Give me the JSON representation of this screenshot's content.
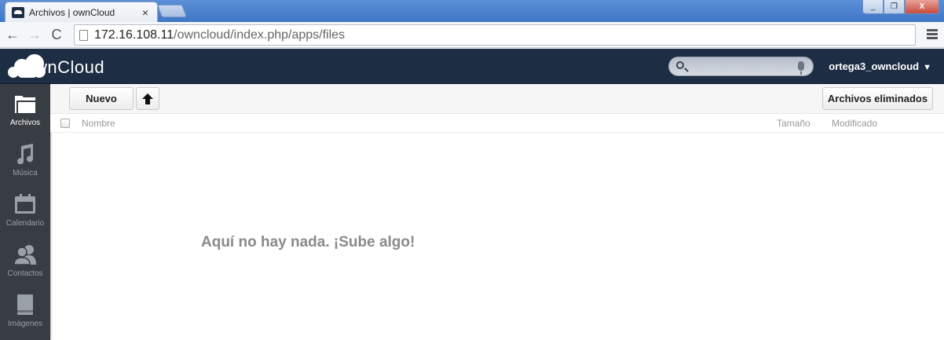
{
  "browser": {
    "tab_title": "Archivos | ownCloud",
    "tab_close": "×",
    "url_host": "172.16.108.11",
    "url_path": "/owncloud/index.php/apps/files",
    "back_glyph": "←",
    "forward_glyph": "→",
    "reload_glyph": "C",
    "window_buttons": [
      "_",
      "❐",
      "X"
    ]
  },
  "header": {
    "logo_text": "wnCloud",
    "search_placeholder": "",
    "user": "ortega3_owncloud",
    "user_caret": "▼"
  },
  "appnav": {
    "items": [
      {
        "label": "Archivos",
        "icon": "folder-icon",
        "active": true
      },
      {
        "label": "Música",
        "icon": "music-note-icon",
        "active": false
      },
      {
        "label": "Calendario",
        "icon": "calendar-icon",
        "active": false
      },
      {
        "label": "Contactos",
        "icon": "contacts-icon",
        "active": false
      },
      {
        "label": "Imágenes",
        "icon": "image-icon",
        "active": false
      }
    ]
  },
  "controls": {
    "new_label": "Nuevo",
    "trash_label": "Archivos eliminados"
  },
  "filelist": {
    "col_name": "Nombre",
    "col_size": "Tamaño",
    "col_modified": "Modificado",
    "empty_message": "Aquí no hay nada. ¡Sube algo!"
  },
  "colors": {
    "header_bg": "#1d2d44",
    "sidebar_bg": "#383c43",
    "empty_text": "#8a8a8a"
  }
}
